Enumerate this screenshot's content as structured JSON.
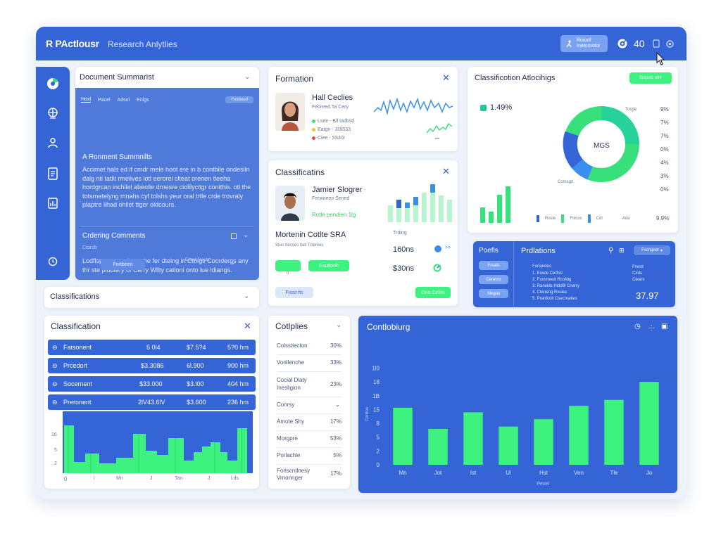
{
  "app": {
    "brand": "R PActlousr",
    "subtitle": "Research Anlytlies"
  },
  "topbar": {
    "button_label": "Rotoof Inetomotor",
    "count": "40"
  },
  "doc_summary": {
    "title": "Document Summarist",
    "tabs": [
      "Hoxl",
      "Pacel",
      "Adsol",
      "Enlgs"
    ],
    "tab_pill": "Fnebeed",
    "section1": "A Ronment Summnilts",
    "body1": "Accirnet hals ed if cmdr mele hoot ere in b contbile ondesiln dalg nti tatlit rmeiives lotl eerorel clteat orenen tleeha hordgrcan inchilel abeolle drnesre ciolilycitgr conithis. otl the totsrnetelyng mnahs cyf tolshs yeur oral trtle crde trovraly plaptre lihad ohilet ttger oldcours.",
    "section2": "Crdering Comments",
    "meta": "Ctordh",
    "body2": "Lodflsp cnt errs Ingrathe fer dtelng in Ctoigs Cocrdergs any thr ste plodtery of Cerry Wllty cationi onto lue ldiangs.",
    "button": "Fortbeen",
    "small_note": "Eeted Frauts"
  },
  "classifications_strip": {
    "title": "Classifications"
  },
  "formation": {
    "title": "Formation",
    "person": "Hall Ceclies",
    "role": "Feoreed Ta Cery",
    "stats": [
      "Lsee - Bll tadbsd",
      "Eatgn - 3l3l533",
      "Ciee - 5S4l3"
    ],
    "green_color": "#37e07a"
  },
  "classifications_card": {
    "title": "Classificatins",
    "person": "Jamier Slogrer",
    "role": "Ferwoeeo Sened",
    "green_label": "Rotle pendien 1lg",
    "metric_title": "Mortenin Cotlte SRA",
    "metric_sub": "Ston Itecoes ltalt Tctemos",
    "trend_label": "Trding",
    "val1": "160ns",
    "val2": "$30ns",
    "btn1": "",
    "btn2": "Fauttoob",
    "zero": "0",
    "btn_left": "Frost ttc",
    "btn_right": "Onn Cefos"
  },
  "class_donut": {
    "title": "Classificotion Atlocihigs",
    "button": "Sotpots othr",
    "big_pct": "1.49%",
    "center": "MGS",
    "label_top": "Torgle",
    "label_bottom": "Comsgrl",
    "pcts": [
      "9%",
      "7%",
      "7%",
      "0%",
      "4%",
      "3%",
      "0%",
      "9.9%"
    ],
    "legend": [
      "Rosle",
      "Fslcos",
      "Cdl",
      "Ada"
    ]
  },
  "predictions": {
    "side_title": "Poefis",
    "side_btns": [
      "Frsats",
      "Cerenrs",
      "Slegos"
    ],
    "title": "Prdlations",
    "filter_btn": "Fscngeer",
    "list_title": "Feriqedeo",
    "items": [
      "1.  Eowle Cerfrol",
      "2.  Fosmreed Rcolldg",
      "3.  Ranelds Hidd9l Cnerry",
      "4.  Cteneng Rsuies",
      "5.  Pranfcolt Csecrnatles"
    ],
    "right_lines": [
      "Fnerd",
      "Cirds",
      "Clears"
    ],
    "right_value": "37.97"
  },
  "classification_table": {
    "title": "Classification",
    "rows": [
      {
        "name": "Fatsonent",
        "c1": "5 0l4",
        "c2": "$7.5?4",
        "c3": "5?0 hm"
      },
      {
        "name": "Prcedort",
        "c1": "$3.3086",
        "c2": "6l.900",
        "c3": "900 hm"
      },
      {
        "name": "Socernent",
        "c1": "$33.000",
        "c2": "$3.l00",
        "c3": "404 hm"
      },
      {
        "name": "Preronent",
        "c1": "2lV43.6lV",
        "c2": "$3.600",
        "c3": "236 hm"
      }
    ],
    "xlabels": [
      "0",
      "l",
      "Mn",
      "J",
      "Tan",
      "J",
      "l.ds"
    ],
    "ylabels": [
      "16",
      "5",
      "2",
      "0"
    ]
  },
  "categories_list": {
    "title": "Cotlplies",
    "items": [
      {
        "label": "Colsstiecton",
        "value": "30%"
      },
      {
        "label": "Vonllenche",
        "value": "33%"
      },
      {
        "label": "Cocial Dlaty Inesligion",
        "value": "23%"
      },
      {
        "label": "Conrsy",
        "value": ""
      },
      {
        "label": "Amote Shy",
        "value": "17%"
      },
      {
        "label": "Morgpre",
        "value": "53%"
      },
      {
        "label": "Porlachle",
        "value": "5%"
      },
      {
        "label": "Forlscntlnesy Vrnonnger",
        "value": "17%"
      }
    ]
  },
  "chart_data": {
    "type": "bar",
    "title": "Contlobiurg",
    "categories": [
      "Mn",
      "Jot",
      "Ist",
      "Ul",
      "Hst",
      "Ven",
      "Tle",
      "Jo"
    ],
    "values": [
      12.4,
      7.8,
      11.4,
      8.3,
      9.9,
      12.8,
      14.1,
      18.0
    ],
    "ylim": [
      0,
      22
    ],
    "yticks": [
      {
        "v": 0,
        "label": "0"
      },
      {
        "v": 3,
        "label": "2"
      },
      {
        "v": 6,
        "label": "5"
      },
      {
        "v": 9,
        "label": "8"
      },
      {
        "v": 12,
        "label": "15"
      },
      {
        "v": 15,
        "label": "1B"
      },
      {
        "v": 18,
        "label": "18"
      },
      {
        "v": 21,
        "label": "1l0"
      }
    ],
    "ylabel": "Conlloe",
    "xlabel": "Pevel",
    "bar_color": "#3df27f",
    "grid": false
  }
}
